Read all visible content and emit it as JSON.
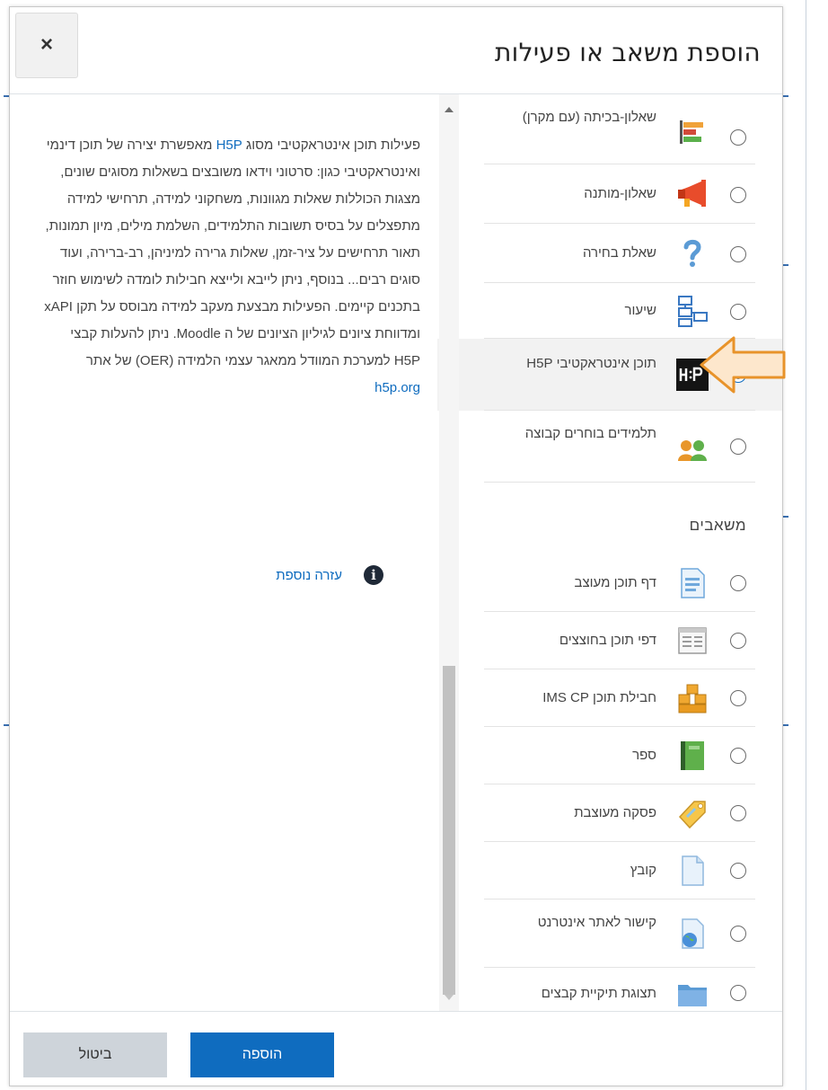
{
  "modal": {
    "title": "הוספת משאב או פעילות",
    "close_symbol": "×"
  },
  "activities": [
    {
      "label": "שאלון-בכיתה (עם מקרן)",
      "icon": "in-class-poll-icon",
      "selected": false
    },
    {
      "label": "שאלון-מותנה",
      "icon": "megaphone-icon",
      "selected": false
    },
    {
      "label": "שאלת בחירה",
      "icon": "question-mark-icon",
      "selected": false
    },
    {
      "label": "שיעור",
      "icon": "lesson-flowchart-icon",
      "selected": false
    },
    {
      "label": "תוכן אינטראקטיבי H5P",
      "icon": "h5p-icon",
      "selected": true
    },
    {
      "label": "תלמידים בוחרים קבוצה",
      "icon": "group-choice-icon",
      "selected": false
    }
  ],
  "resources_heading": "משאבים",
  "resources": [
    {
      "label": "דף תוכן מעוצב",
      "icon": "page-icon"
    },
    {
      "label": "דפי תוכן בחוצצים",
      "icon": "tabbed-pages-icon"
    },
    {
      "label": "חבילת תוכן IMS CP",
      "icon": "ims-package-icon"
    },
    {
      "label": "ספר",
      "icon": "book-icon"
    },
    {
      "label": "פסקה מעוצבת",
      "icon": "label-tag-icon"
    },
    {
      "label": "קובץ",
      "icon": "file-icon"
    },
    {
      "label": "קישור לאתר אינטרנט",
      "icon": "url-globe-icon"
    },
    {
      "label": "תצוגת תיקיית קבצים",
      "icon": "folder-icon"
    }
  ],
  "help": {
    "p1": "פעילות תוכן אינטראקטיבי מסוג ",
    "p1_link": "H5P",
    "p2": " מאפשרת יצירה של תוכן דינמי ואינטראקטיבי כגון: סרטוני וידאו משובצים בשאלות מסוגים שונים, מצגות הכוללות שאלות מגוונות, משחקוני למידה, תרחישי למידה מתפצלים על בסיס תשובות התלמידים, השלמת מילים, מיון תמונות, תאור תרחישים על ציר-זמן, שאלות גרירה למיניהן, רב-ברירה, ועוד סוגים רבים... בנוסף, ניתן לייבא ולייצא חבילות לומדה לשימוש חוזר בתכנים קיימים. הפעילות מבצעת מעקב למידה מבוסס על תקן xAPI ומדווחת ציונים לגיליון הציונים של ה Moodle. ניתן להעלות קבצי H5P למערכת המוודל ממאגר עצמי הלמידה (OER) של אתר",
    "link": "h5p.org",
    "more_help": "עזרה נוספת"
  },
  "footer": {
    "add": "הוספה",
    "cancel": "ביטול"
  },
  "colors": {
    "accent": "#0f6cbf",
    "arrow_fill": "#fde7cc",
    "arrow_stroke": "#e8932a"
  }
}
